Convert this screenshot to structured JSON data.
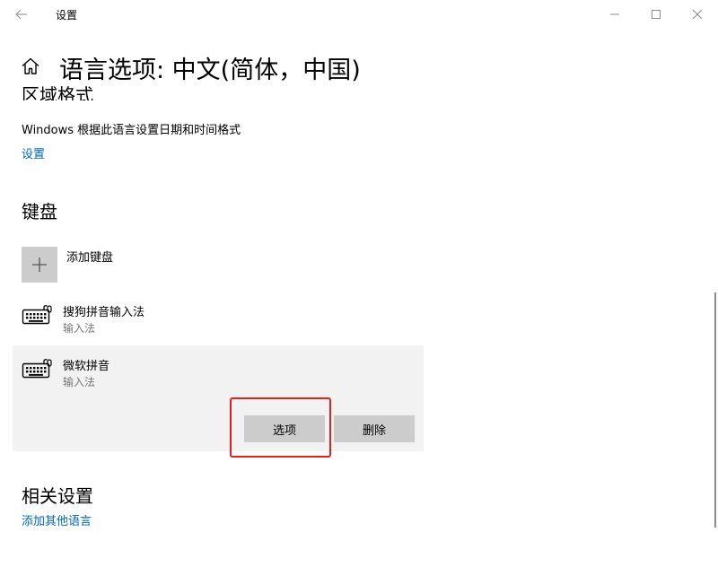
{
  "window": {
    "title": "设置"
  },
  "header": {
    "title": "语言选项: 中文(简体，中国)"
  },
  "region": {
    "heading": "区域格式",
    "description": "Windows 根据此语言设置日期和时间格式",
    "settings_link": "设置"
  },
  "keyboard": {
    "heading": "键盘",
    "add_label": "添加键盘",
    "items": [
      {
        "name": "搜狗拼音输入法",
        "type": "输入法"
      },
      {
        "name": "微软拼音",
        "type": "输入法"
      }
    ],
    "options_button": "选项",
    "remove_button": "删除"
  },
  "related": {
    "heading": "相关设置",
    "add_language_link": "添加其他语言"
  },
  "colors": {
    "link": "#0067b8",
    "highlight_box": "#e02020",
    "selected_bg": "#f2f2f2",
    "button_bg": "#cccccc"
  }
}
